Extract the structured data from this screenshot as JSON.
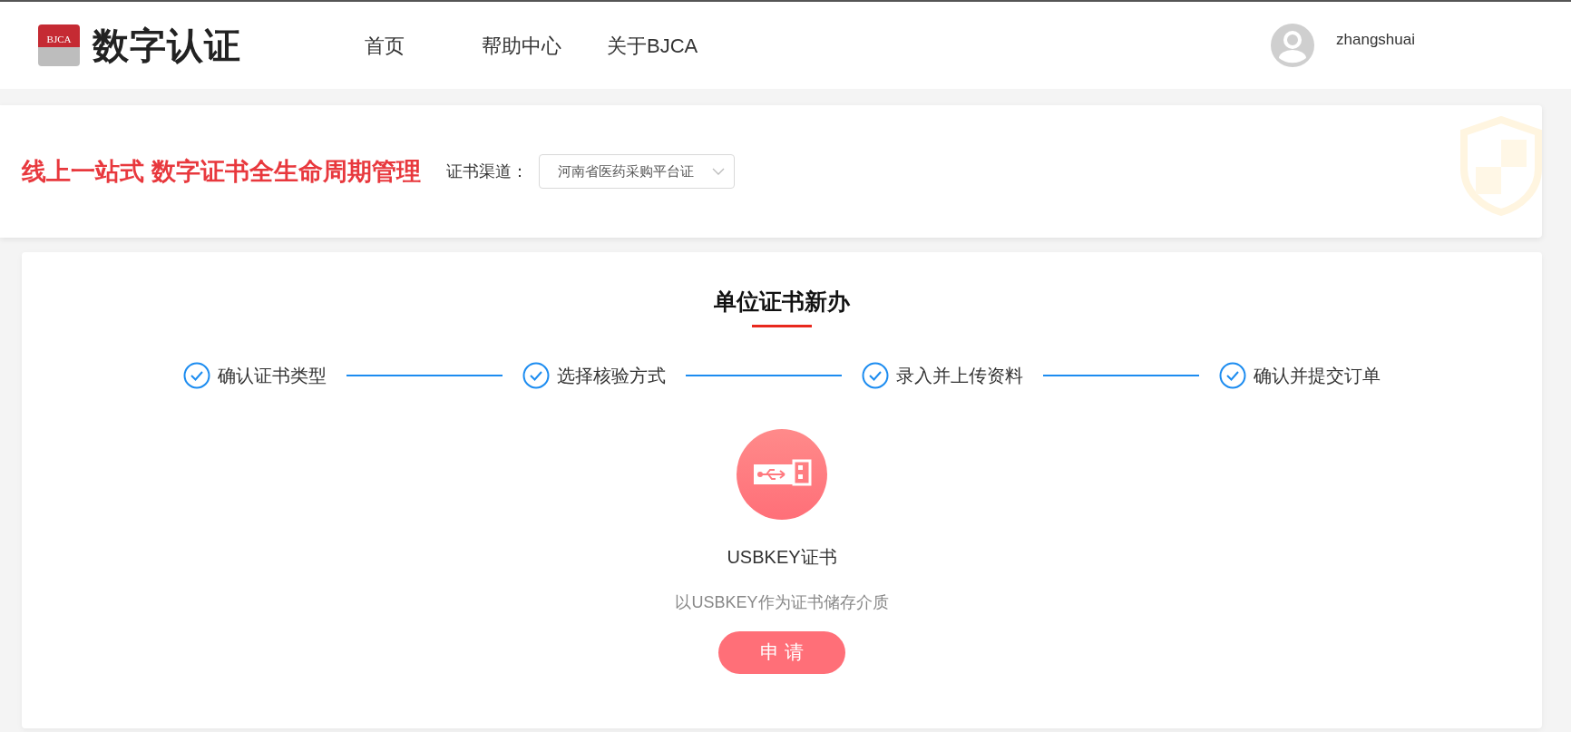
{
  "header": {
    "logo": {
      "badge_text": "BJCA",
      "title": "数字认证"
    },
    "nav": [
      {
        "label": "首页"
      },
      {
        "label": "帮助中心"
      },
      {
        "label": "关于BJCA"
      }
    ],
    "user": {
      "name": "zhangshuai"
    }
  },
  "banner": {
    "slogan": "线上一站式 数字证书全生命周期管理",
    "channel_label": "证书渠道：",
    "channel_value": "河南省医药采购平台证"
  },
  "main": {
    "title": "单位证书新办",
    "steps": [
      {
        "label": "确认证书类型"
      },
      {
        "label": "选择核验方式"
      },
      {
        "label": "录入并上传资料"
      },
      {
        "label": "确认并提交订单"
      }
    ],
    "product": {
      "title": "USBKEY证书",
      "description": "以USBKEY作为证书储存介质",
      "button": "申 请"
    }
  }
}
